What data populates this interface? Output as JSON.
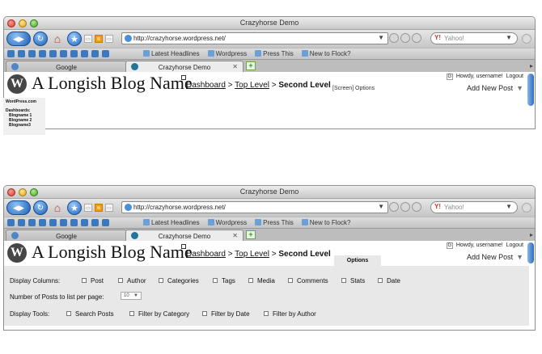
{
  "browser": {
    "window_title": "Crazyhorse Demo",
    "url": "http://crazyhorse.wordpress.net/",
    "search_placeholder": "Yahoo!",
    "bookmarks": [
      "Latest Headlines",
      "Wordpress",
      "Press This",
      "New to Flock?"
    ],
    "tabs": [
      {
        "label": "Google"
      },
      {
        "label": "Crazyhorse Demo"
      }
    ]
  },
  "wp": {
    "logo_letter": "W",
    "blog_name": "A Longish Blog Name",
    "breadcrumb": {
      "level1": "Dashboard",
      "sep1": " > ",
      "level2": "Top Level",
      "sep2": " > ",
      "current": "Second Level"
    },
    "screen_options_text": "[Screen] Options",
    "howdy": "Howdy, username!",
    "logout": "Logout",
    "g_icon": "G",
    "add_new": "Add New Post",
    "sidebar": {
      "site": "WordPress.com",
      "dashboards_label": "Dashboards:",
      "blogs": [
        "Blogname 1",
        "Blogname 2",
        "Blogname3"
      ]
    }
  },
  "options": {
    "tab_label": "Options",
    "display_columns_label": "Display Columns:",
    "columns": [
      "Post",
      "Author",
      "Categories",
      "Tags",
      "Media",
      "Comments",
      "Stats",
      "Date"
    ],
    "posts_per_page_label": "Number of Posts to list per page:",
    "posts_per_page_value": "10",
    "display_tools_label": "Display Tools:",
    "tools": [
      "Search Posts",
      "Filter by Category",
      "Filter by Date",
      "Filter by Author"
    ]
  },
  "colors": {
    "wp_logo": "#464646",
    "panel_bg": "#e8e8e8",
    "nav_blue": "#1d5fb4"
  }
}
